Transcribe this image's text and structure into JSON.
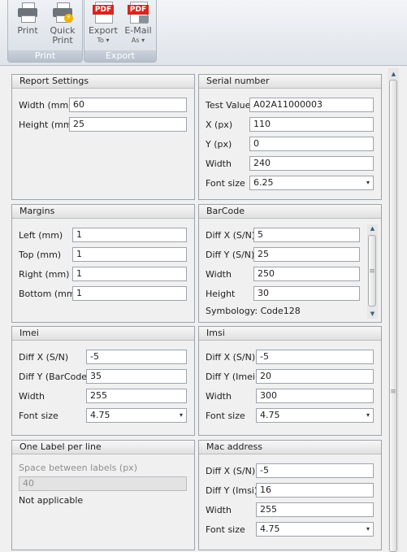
{
  "ribbon": {
    "print_group": {
      "label": "Print",
      "print": [
        "Print"
      ],
      "quick_print": [
        "Quick",
        "Print"
      ]
    },
    "export_group": {
      "label": "Export",
      "export_to": [
        "Export",
        "To ▾"
      ],
      "email_as": [
        "E-Mail",
        "As ▾"
      ]
    },
    "pdf_tag": "PDF"
  },
  "report_settings": {
    "title": "Report Settings",
    "width_label": "Width (mm)",
    "width": "60",
    "height_label": "Height (mm)",
    "height": "25"
  },
  "serial_number": {
    "title": "Serial number",
    "test_value_label": "Test Value",
    "test_value": "A02A11000003",
    "x_label": "X (px)",
    "x": "110",
    "y_label": "Y (px)",
    "y": "0",
    "width_label": "Width",
    "width": "240",
    "font_size_label": "Font size",
    "font_size": "6.25"
  },
  "margins": {
    "title": "Margins",
    "left_label": "Left (mm)",
    "left": "1",
    "top_label": "Top (mm)",
    "top": "1",
    "right_label": "Right (mm)",
    "right": "1",
    "bottom_label": "Bottom (mm)",
    "bottom": "1"
  },
  "barcode": {
    "title": "BarCode",
    "diff_x_label": "Diff X (S/N)",
    "diff_x": "5",
    "diff_y_label": "Diff Y (S/N)",
    "diff_y": "25",
    "width_label": "Width",
    "width": "250",
    "height_label": "Height",
    "height": "30",
    "symbology": "Symbology: Code128"
  },
  "imei": {
    "title": "Imei",
    "diff_x_label": "Diff X (S/N)",
    "diff_x": "-5",
    "diff_y_label": "Diff Y (BarCode)",
    "diff_y": "35",
    "width_label": "Width",
    "width": "255",
    "font_size_label": "Font size",
    "font_size": "4.75"
  },
  "imsi": {
    "title": "Imsi",
    "diff_x_label": "Diff X (S/N)",
    "diff_x": "-5",
    "diff_y_label": "Diff Y (Imei)",
    "diff_y": "20",
    "width_label": "Width",
    "width": "300",
    "font_size_label": "Font size",
    "font_size": "4.75"
  },
  "one_label": {
    "title": "One Label per line",
    "space_label": "Space between labels (px)",
    "space": "40",
    "note": "Not applicable"
  },
  "mac_address": {
    "title": "Mac address",
    "diff_x_label": "Diff X (S/N)",
    "diff_x": "-5",
    "diff_y_label": "Diff Y (Imsi)",
    "diff_y": "16",
    "width_label": "Width",
    "width": "255",
    "font_size_label": "Font size",
    "font_size": "4.75"
  },
  "icons": {
    "dropdown": "▾",
    "scroll_up": "▲",
    "scroll_down": "▼",
    "grip": "≡"
  },
  "colors": {
    "pdf_red": "#d7261e",
    "ribbon_group": "#b6c0cc",
    "scroll_arrow": "#3d5c86"
  }
}
